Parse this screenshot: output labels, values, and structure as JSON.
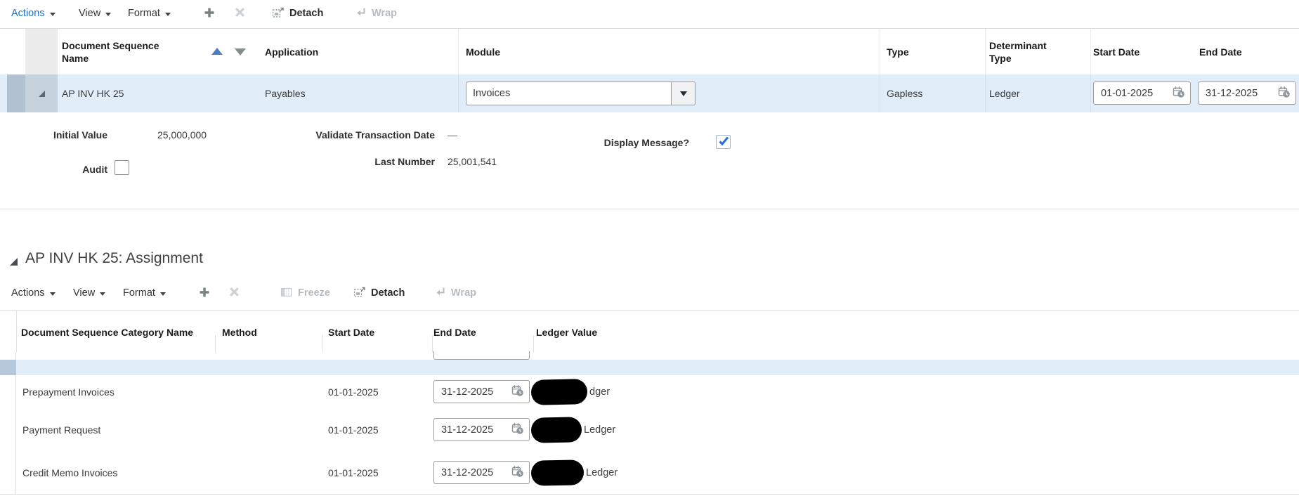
{
  "colors": {
    "link_blue": "#1a6fd0",
    "selection_bg": "#e1eefa",
    "selector_gutter": "#b1c1d0",
    "check_blue": "#2a72cd",
    "redaction": "#000000"
  },
  "toolbar_top": {
    "actions": "Actions",
    "view": "View",
    "format": "Format",
    "detach": "Detach",
    "wrap": "Wrap"
  },
  "sequence_table": {
    "headers": {
      "name": "Document Sequence Name",
      "application": "Application",
      "module": "Module",
      "type": "Type",
      "determinant_type": "Determinant Type",
      "start_date": "Start Date",
      "end_date": "End Date"
    },
    "row": {
      "name": "AP INV HK 25",
      "application": "Payables",
      "module": "Invoices",
      "type": "Gapless",
      "determinant_type": "Ledger",
      "start_date": "01-01-2025",
      "end_date": "31-12-2025"
    }
  },
  "details": {
    "initial_value_label": "Initial Value",
    "initial_value": "25,000,000",
    "validate_transaction_date_label": "Validate Transaction Date",
    "validate_transaction_date": "—",
    "display_message_label": "Display Message?",
    "display_message_checked": true,
    "last_number_label": "Last Number",
    "last_number": "25,001,541",
    "audit_label": "Audit",
    "audit_checked": false
  },
  "assignment_section": {
    "title": "AP INV HK 25: Assignment",
    "toolbar": {
      "actions": "Actions",
      "view": "View",
      "format": "Format",
      "freeze": "Freeze",
      "detach": "Detach",
      "wrap": "Wrap"
    },
    "table": {
      "headers": {
        "category_name": "Document Sequence Category Name",
        "method": "Method",
        "start_date": "Start Date",
        "end_date": "End Date",
        "ledger_value": "Ledger Value"
      },
      "rows": [
        {
          "category_name": "Prepayment Invoices",
          "method": "",
          "start_date": "01-01-2025",
          "end_date": "31-12-2025",
          "ledger_value_visible": "dger",
          "ledger_redacted": true
        },
        {
          "category_name": "Payment Request",
          "method": "",
          "start_date": "01-01-2025",
          "end_date": "31-12-2025",
          "ledger_value_visible": "Ledger",
          "ledger_redacted": true
        },
        {
          "category_name": "Credit Memo Invoices",
          "method": "",
          "start_date": "01-01-2025",
          "end_date": "31-12-2025",
          "ledger_value_visible": "Ledger",
          "ledger_redacted": true
        }
      ]
    }
  }
}
